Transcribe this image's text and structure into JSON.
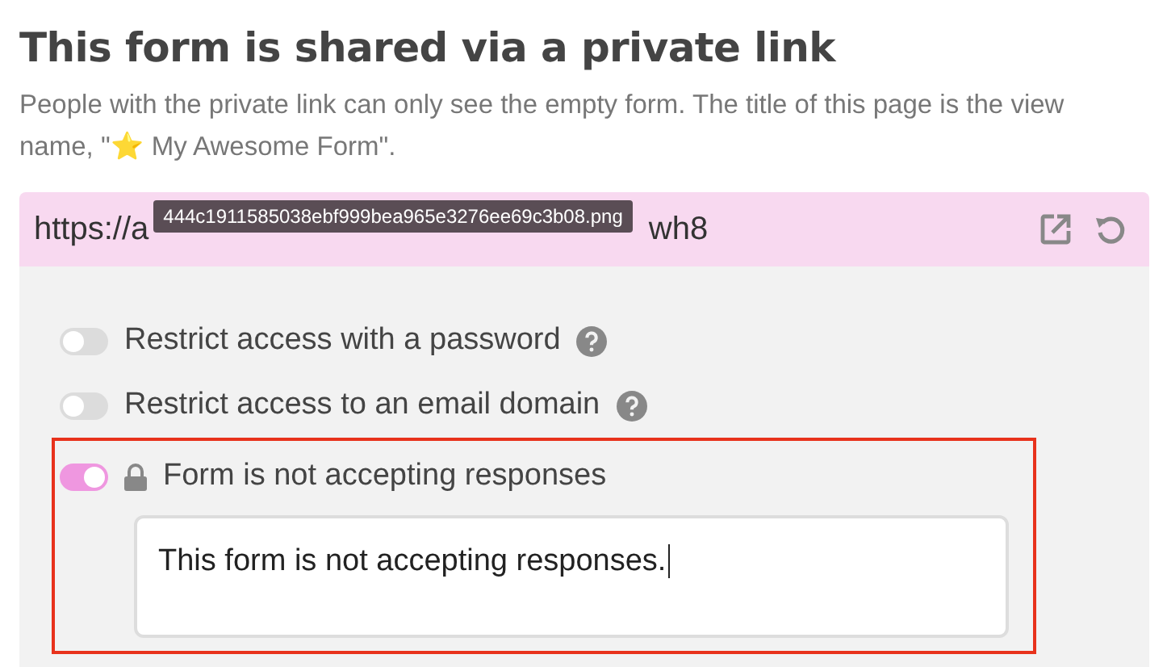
{
  "heading": "This form is shared via a private link",
  "description": "People with the private link can only see the empty form. The title of this page is the view name, \"⭐️ My Awesome Form\".",
  "link": {
    "url_start": "https://a",
    "url_end": "wh8",
    "tooltip": "444c1911585038ebf999bea965e3276ee69c3b08.png"
  },
  "options": [
    {
      "kind": "help",
      "label": "Restrict access with a password",
      "on": false,
      "highlighted": false
    },
    {
      "kind": "help",
      "label": "Restrict access to an email domain",
      "on": false,
      "highlighted": false
    },
    {
      "kind": "locked",
      "label": "Form is not accepting responses",
      "on": true,
      "highlighted": true,
      "message": "This form is not accepting responses."
    }
  ]
}
